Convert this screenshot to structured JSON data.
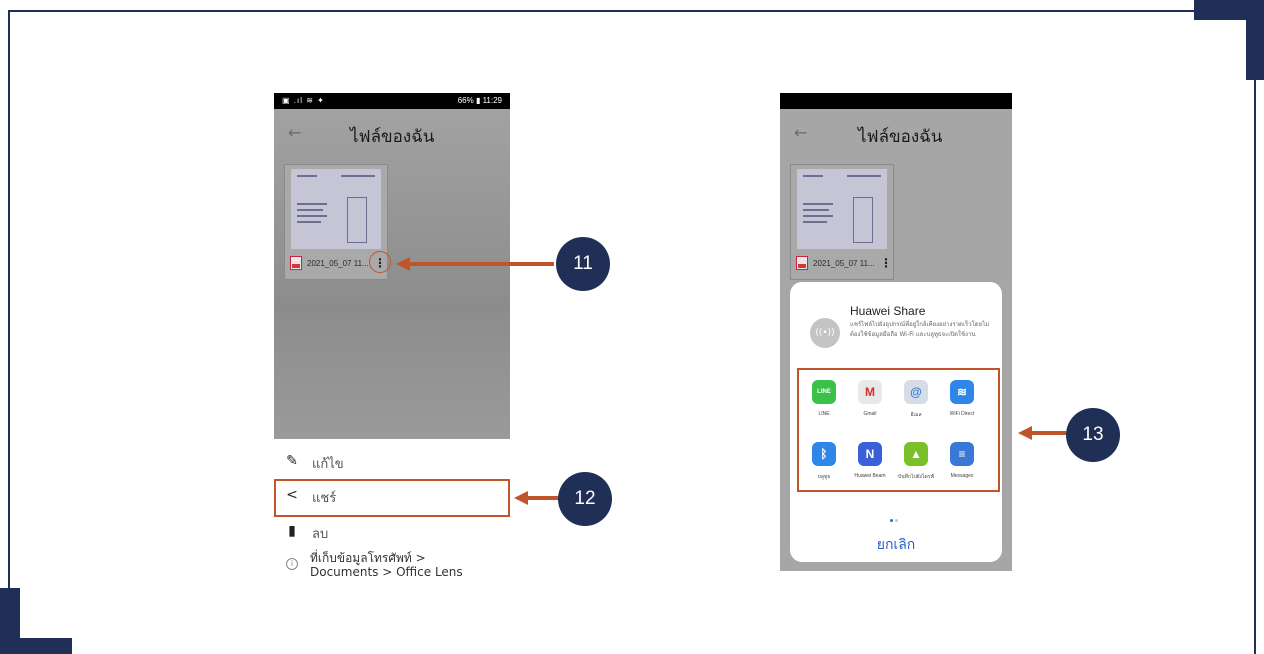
{
  "phone1": {
    "status_left": "▣ .ıl ≋ ✦",
    "status_right": "66% ▮ 11:29",
    "back_icon": "←",
    "title": "ไฟล์ของฉัน",
    "file_name": "2021_05_07 11...",
    "more_icon": "⋮",
    "sheet": {
      "edit_label": "แก้ไข",
      "share_label": "แชร์",
      "delete_label": "ลบ",
      "info_line1": "ที่เก็บข้อมูลโทรศัพท์ >",
      "info_line2": "Documents > Office Lens"
    }
  },
  "phone2": {
    "back_icon": "←",
    "title": "ไฟล์ของฉัน",
    "file_name": "2021_05_07 11...",
    "more_icon": "⋮",
    "share_sheet": {
      "huawei_share_title": "Huawei Share",
      "huawei_share_desc": "แชร์ไฟล์ไปยังอุปกรณ์ที่อยู่ใกล้เคียงอย่างรวดเร็วโดยไม่ต้องใช้ข้อมูลมือถือ Wi-Fi และบลูทูธจะเปิดใช้งาน",
      "apps": [
        {
          "label": "LINE",
          "icon": "line-icon",
          "glyph": "LINE",
          "color": "#3ac14a"
        },
        {
          "label": "Gmail",
          "icon": "gmail-icon",
          "glyph": "M",
          "color": "#e8e8e8"
        },
        {
          "label": "อีเมล",
          "icon": "email-icon",
          "glyph": "@",
          "color": "#d7dde6"
        },
        {
          "label": "WiFi Direct",
          "icon": "wifi-direct-icon",
          "glyph": "≋",
          "color": "#2e86e8"
        },
        {
          "label": "บลูทูธ",
          "icon": "bluetooth-icon",
          "glyph": "ᛒ",
          "color": "#2e86e8"
        },
        {
          "label": "Huawei Beam",
          "icon": "huawei-beam-icon",
          "glyph": "N",
          "color": "#3a5fd6"
        },
        {
          "label": "บันทึกไปยังไดรฟ์",
          "icon": "google-drive-icon",
          "glyph": "▲",
          "color": "#7bbf2a"
        },
        {
          "label": "Messages",
          "icon": "messages-icon",
          "glyph": "≡",
          "color": "#3a78d8"
        }
      ],
      "cancel_label": "ยกเลิก"
    }
  },
  "callouts": {
    "step11": "11",
    "step12": "12",
    "step13": "13"
  },
  "colors": {
    "navy": "#1f2f55",
    "annotation": "#c0552c"
  }
}
